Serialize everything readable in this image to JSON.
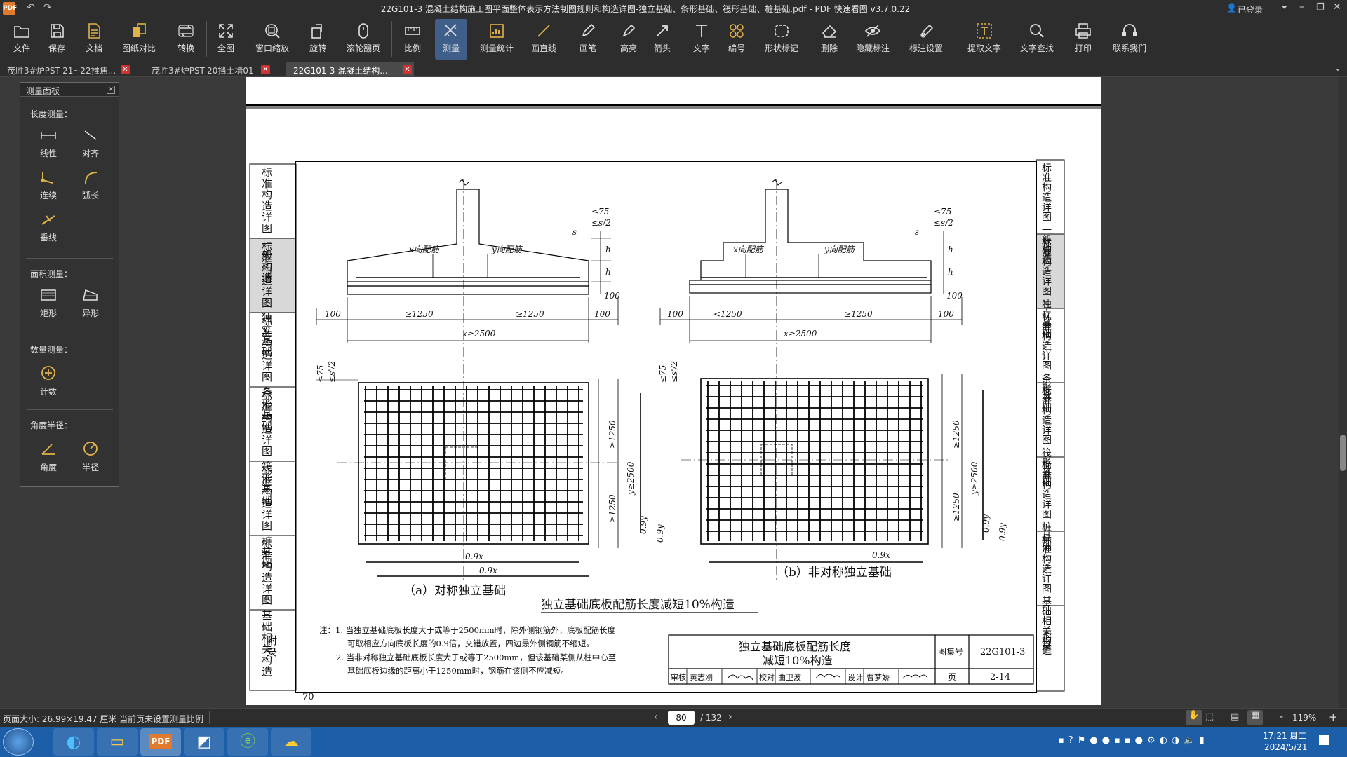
{
  "window": {
    "title": "22G101-3 混凝土结构施工图平面整体表示方法制图规则和构造详图-独立基础、条形基础、筏形基础、桩基础.pdf - PDF 快速看图 v3.7.0.22",
    "login": "已登录"
  },
  "toolbar": {
    "file": "文件",
    "save": "保存",
    "doc": "文档",
    "compare": "图纸对比",
    "convert": "转换",
    "fullview": "全图",
    "winzoom": "窗口缩放",
    "rotate": "旋转",
    "scrollpage": "滚轮翻页",
    "scale": "比例",
    "measure": "测量",
    "measure_stats": "测量统计",
    "line": "画直线",
    "pen": "画笔",
    "highlight": "高亮",
    "arrow": "箭头",
    "text": "文字",
    "number": "编号",
    "shape": "形状标记",
    "delete": "删除",
    "hide": "隐藏标注",
    "markset": "标注设置",
    "extract": "提取文字",
    "findtext": "文字查找",
    "print": "打印",
    "contact": "联系我们"
  },
  "tabs": [
    {
      "label": "茂胜3#炉PST-21~22推焦..."
    },
    {
      "label": "茂胜3#炉PST-20挡土墙01"
    },
    {
      "label": "22G101-3 混凝土结构..."
    }
  ],
  "panel": {
    "title": "测量面板",
    "length_title": "长度测量：",
    "linear": "线性",
    "align": "对齐",
    "continuous": "连续",
    "arc": "弧长",
    "perp": "垂线",
    "area_title": "面积测量：",
    "rect": "矩形",
    "irregular": "异形",
    "count_title": "数量测量：",
    "count": "计数",
    "angle_title": "角度半径：",
    "angle": "角度",
    "radius": "半径"
  },
  "drawing": {
    "side_tabs": [
      "标准构造详图 一般构造",
      "标准构造详图 独立基础",
      "标准构造详图 条形基础",
      "标准构造详图 筏形基础",
      "标准构造详图 桩基础",
      "标准构造详图 基础相关构造",
      "附录"
    ],
    "caption_a": "（a）对称独立基础",
    "caption_b": "（b）非对称独立基础",
    "main_title": "独立基础底板配筋长度减短10%构造",
    "note_1": "注：1. 当独立基础底板长度大于或等于2500mm时，除外侧钢筋外，底板配筋长度",
    "note_2": "可取相应方向底板长度的0.9倍，交错放置，四边最外侧钢筋不缩短。",
    "note_3": "2. 当非对称独立基础底板长度大于或等于2500mm，但该基础某侧从柱中心至",
    "note_4": "基础底板边缘的距离小于1250mm时，钢筋在该侧不应减短。",
    "tb_title_1": "独立基础底板配筋长度",
    "tb_title_2": "减短10%构造",
    "tb_atlas_label": "图集号",
    "tb_atlas": "22G101-3",
    "tb_page_label": "页",
    "tb_page": "2-14",
    "tb_review": "审核",
    "tb_review_name": "黄志刚",
    "tb_check": "校对",
    "tb_check_name": "曲卫波",
    "tb_design": "设计",
    "tb_design_name": "曹梦娇",
    "page_no": "70",
    "x_rebar": "x向配筋",
    "y_rebar": "y向配筋",
    "dim_ge1250": "≥1250",
    "dim_lt1250": "<1250",
    "dim_100": "100",
    "dim_x2500": "x≥2500",
    "dim_y2500": "y≥2500",
    "dim_09x": "0.9x",
    "dim_09y": "0.9y",
    "dim_75": "≤75",
    "dim_s2": "≤s/2",
    "dim_s": "s",
    "dim_h": "h",
    "dim_s1": "≤s'/2"
  },
  "status": {
    "pagesize": "页面大小: 26.99×19.47 厘米",
    "scale_note": "当前页未设置测量比例",
    "page_current": "80",
    "page_total": "/ 132",
    "zoom": "119%"
  },
  "taskbar": {
    "time": "17:21 周二",
    "date": "2024/5/21"
  },
  "colors": {
    "accent": "#3f5f8a",
    "icon": "#e0b24a",
    "tab_close": "#cc3333",
    "taskbar": "#1d5ea8"
  }
}
